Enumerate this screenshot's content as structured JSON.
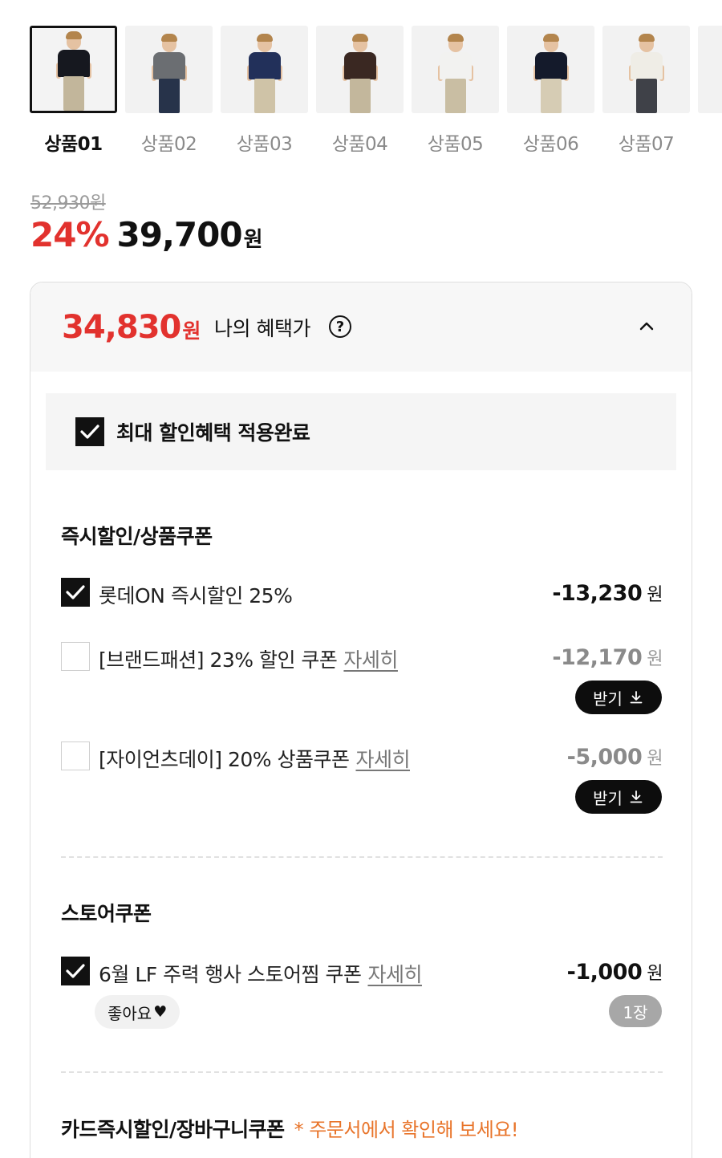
{
  "thumbnails": [
    {
      "label": "상품01",
      "selected": true,
      "shirt": "#16181f",
      "pants": "#c2b69b"
    },
    {
      "label": "상품02",
      "selected": false,
      "shirt": "#6b6e72",
      "pants": "#27334a"
    },
    {
      "label": "상품03",
      "selected": false,
      "shirt": "#22305a",
      "pants": "#cfc3a7"
    },
    {
      "label": "상품04",
      "selected": false,
      "shirt": "#3a2822",
      "pants": "#c3b79c"
    },
    {
      "label": "상품05",
      "selected": false,
      "shirt": "#f2f2f0",
      "pants": "#c9bea3"
    },
    {
      "label": "상품06",
      "selected": false,
      "shirt": "#141a2b",
      "pants": "#d6ccb4"
    },
    {
      "label": "상품07",
      "selected": false,
      "shirt": "#efede6",
      "pants": "#3f4148"
    },
    {
      "label": "상",
      "selected": false,
      "shirt": "#dcdcdc",
      "pants": "#bdbdbd"
    }
  ],
  "price": {
    "original": "52,930원",
    "discount_rate": "24%",
    "sale_price": "39,700",
    "unit": "원"
  },
  "benefit": {
    "price": "34,830",
    "unit": "원",
    "label": "나의 혜택가",
    "help_icon": "?",
    "max_applied": "최대 할인혜택 적용완료"
  },
  "sections": {
    "instant": {
      "title": "즉시할인/상품쿠폰",
      "items": [
        {
          "checked": true,
          "name": "롯데ON 즉시할인 25%",
          "detail": "",
          "amount": "-13,230",
          "won": "원"
        },
        {
          "checked": false,
          "name": "[브랜드패션] 23% 할인 쿠폰",
          "detail": "자세히",
          "amount": "-12,170",
          "won": "원",
          "button": "받기"
        },
        {
          "checked": false,
          "name": "[자이언츠데이] 20% 상품쿠폰",
          "detail": "자세히",
          "amount": "-5,000",
          "won": "원",
          "button": "받기"
        }
      ]
    },
    "store": {
      "title": "스토어쿠폰",
      "items": [
        {
          "checked": true,
          "name": "6월 LF 주력 행사 스토어찜 쿠폰",
          "detail": "자세히",
          "amount": "-1,000",
          "won": "원",
          "chip": "좋아요",
          "qty": "1장"
        }
      ]
    },
    "card": {
      "title": "카드즉시할인/장바구니쿠폰",
      "notice": "* 주문서에서 확인해 보세요!"
    }
  },
  "colors": {
    "accent_red": "#e2322e",
    "notice_orange": "#e8742a",
    "button_black": "#0d0d0d"
  }
}
